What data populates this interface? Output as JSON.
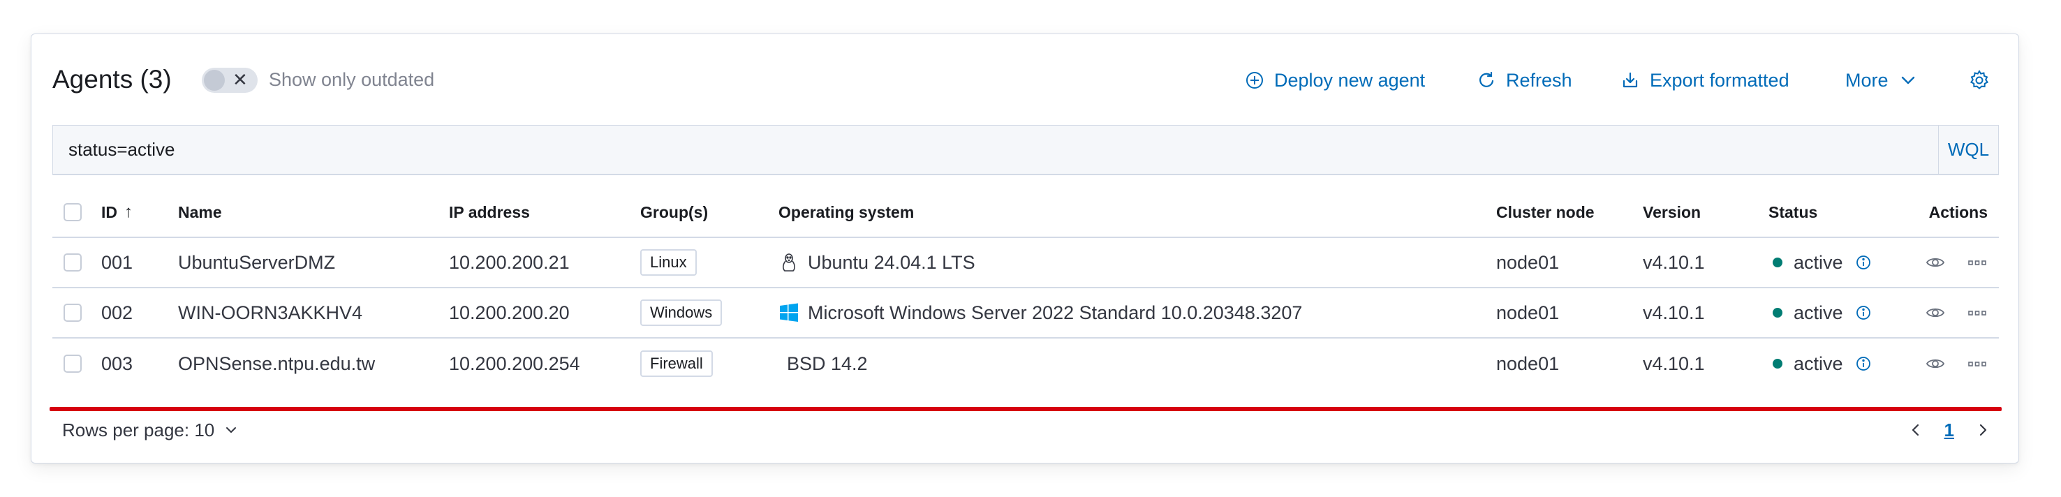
{
  "header": {
    "title": "Agents (3)",
    "toggle_label": "Show only outdated",
    "deploy_label": "Deploy new agent",
    "refresh_label": "Refresh",
    "export_label": "Export formatted",
    "more_label": "More"
  },
  "search": {
    "value": "status=active",
    "wql_label": "WQL"
  },
  "table": {
    "columns": {
      "id": "ID",
      "name": "Name",
      "ip": "IP address",
      "groups": "Group(s)",
      "os": "Operating system",
      "cluster": "Cluster node",
      "version": "Version",
      "status": "Status",
      "actions": "Actions"
    },
    "rows": [
      {
        "id": "001",
        "name": "UbuntuServerDMZ",
        "ip": "10.200.200.21",
        "group": "Linux",
        "os_icon": "linux-icon",
        "os": "Ubuntu 24.04.1 LTS",
        "cluster": "node01",
        "version": "v4.10.1",
        "status": "active"
      },
      {
        "id": "002",
        "name": "WIN-OORN3AKKHV4",
        "ip": "10.200.200.20",
        "group": "Windows",
        "os_icon": "windows-icon",
        "os": "Microsoft Windows Server 2022 Standard 10.0.20348.3207",
        "cluster": "node01",
        "version": "v4.10.1",
        "status": "active"
      },
      {
        "id": "003",
        "name": "OPNSense.ntpu.edu.tw",
        "ip": "10.200.200.254",
        "group": "Firewall",
        "os_icon": "",
        "os": "BSD 14.2",
        "cluster": "node01",
        "version": "v4.10.1",
        "status": "active"
      }
    ]
  },
  "footer": {
    "rows_per_page": "Rows per page: 10",
    "page": "1"
  },
  "colors": {
    "accent": "#006bb8",
    "status_active": "#017d73",
    "highlight_line": "#d6000f",
    "windows_blue": "#00a4ef"
  }
}
